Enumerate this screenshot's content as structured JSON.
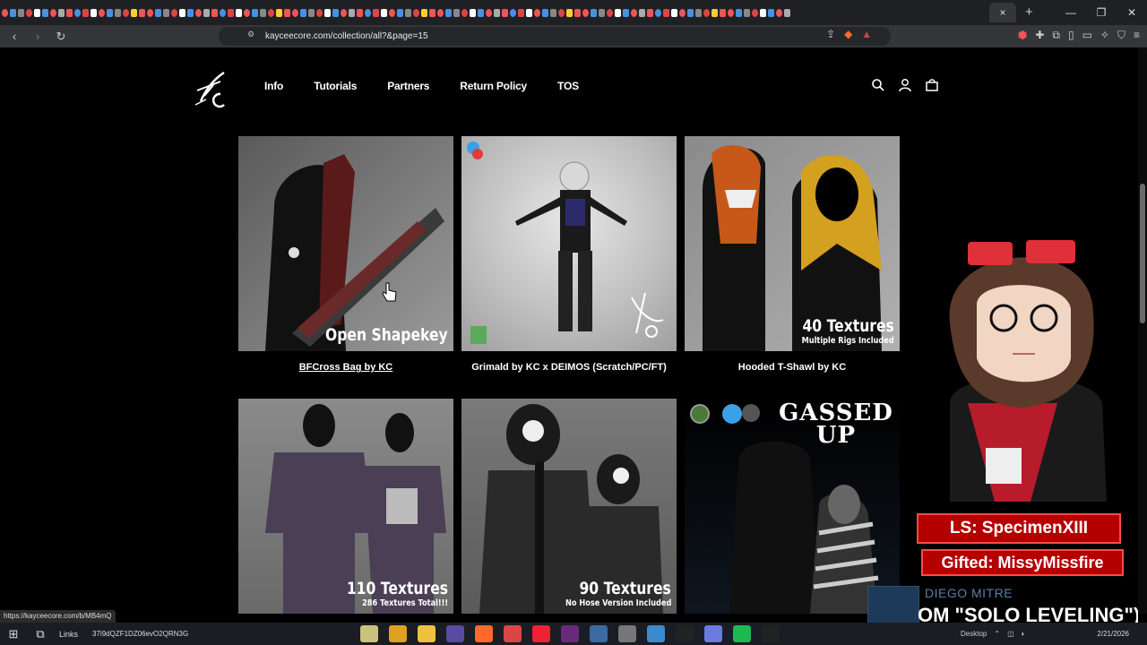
{
  "browser": {
    "active_tab_close": "×",
    "new_tab": "+",
    "url": "kayceecore.com/collection/all?&page=15",
    "status_link": "https://kayceecore.com/b/MB4mQ"
  },
  "site": {
    "nav": [
      "Info",
      "Tutorials",
      "Partners",
      "Return Policy",
      "TOS"
    ]
  },
  "products": [
    {
      "title": "BFCross Bag by KC",
      "overlay": "Open Shapekey",
      "overlay_sub": ""
    },
    {
      "title": "Grimald by KC x DEIMOS (Scratch/PC/FT)",
      "overlay": "",
      "overlay_sub": ""
    },
    {
      "title": "Hooded T-Shawl by KC",
      "overlay": "40 Textures",
      "overlay_sub": "Multiple Rigs Included"
    },
    {
      "title": "",
      "overlay": "110 Textures",
      "overlay_sub": "286 Textures Total!!!"
    },
    {
      "title": "",
      "overlay": "90 Textures",
      "overlay_sub": "No Hose Version Included"
    },
    {
      "title": "",
      "overlay": "GASSED UP",
      "overlay_sub": ""
    }
  ],
  "stream": {
    "last_sub": "LS: SpecimenXIII",
    "gifted": "Gifted: MissyMissfire",
    "song_artist": "DIEGO MITRE",
    "song_title": "OM \"SOLO LEVELING\")"
  },
  "taskbar": {
    "links": "Links",
    "notification": "37i9dQZF1DZ06evO2QRN3G",
    "tray_label": "Desktop",
    "date": "2/21/2026"
  },
  "colors": {
    "accent_red": "#b50000",
    "page_bg": "#000000",
    "chrome_bg": "#35363a"
  }
}
